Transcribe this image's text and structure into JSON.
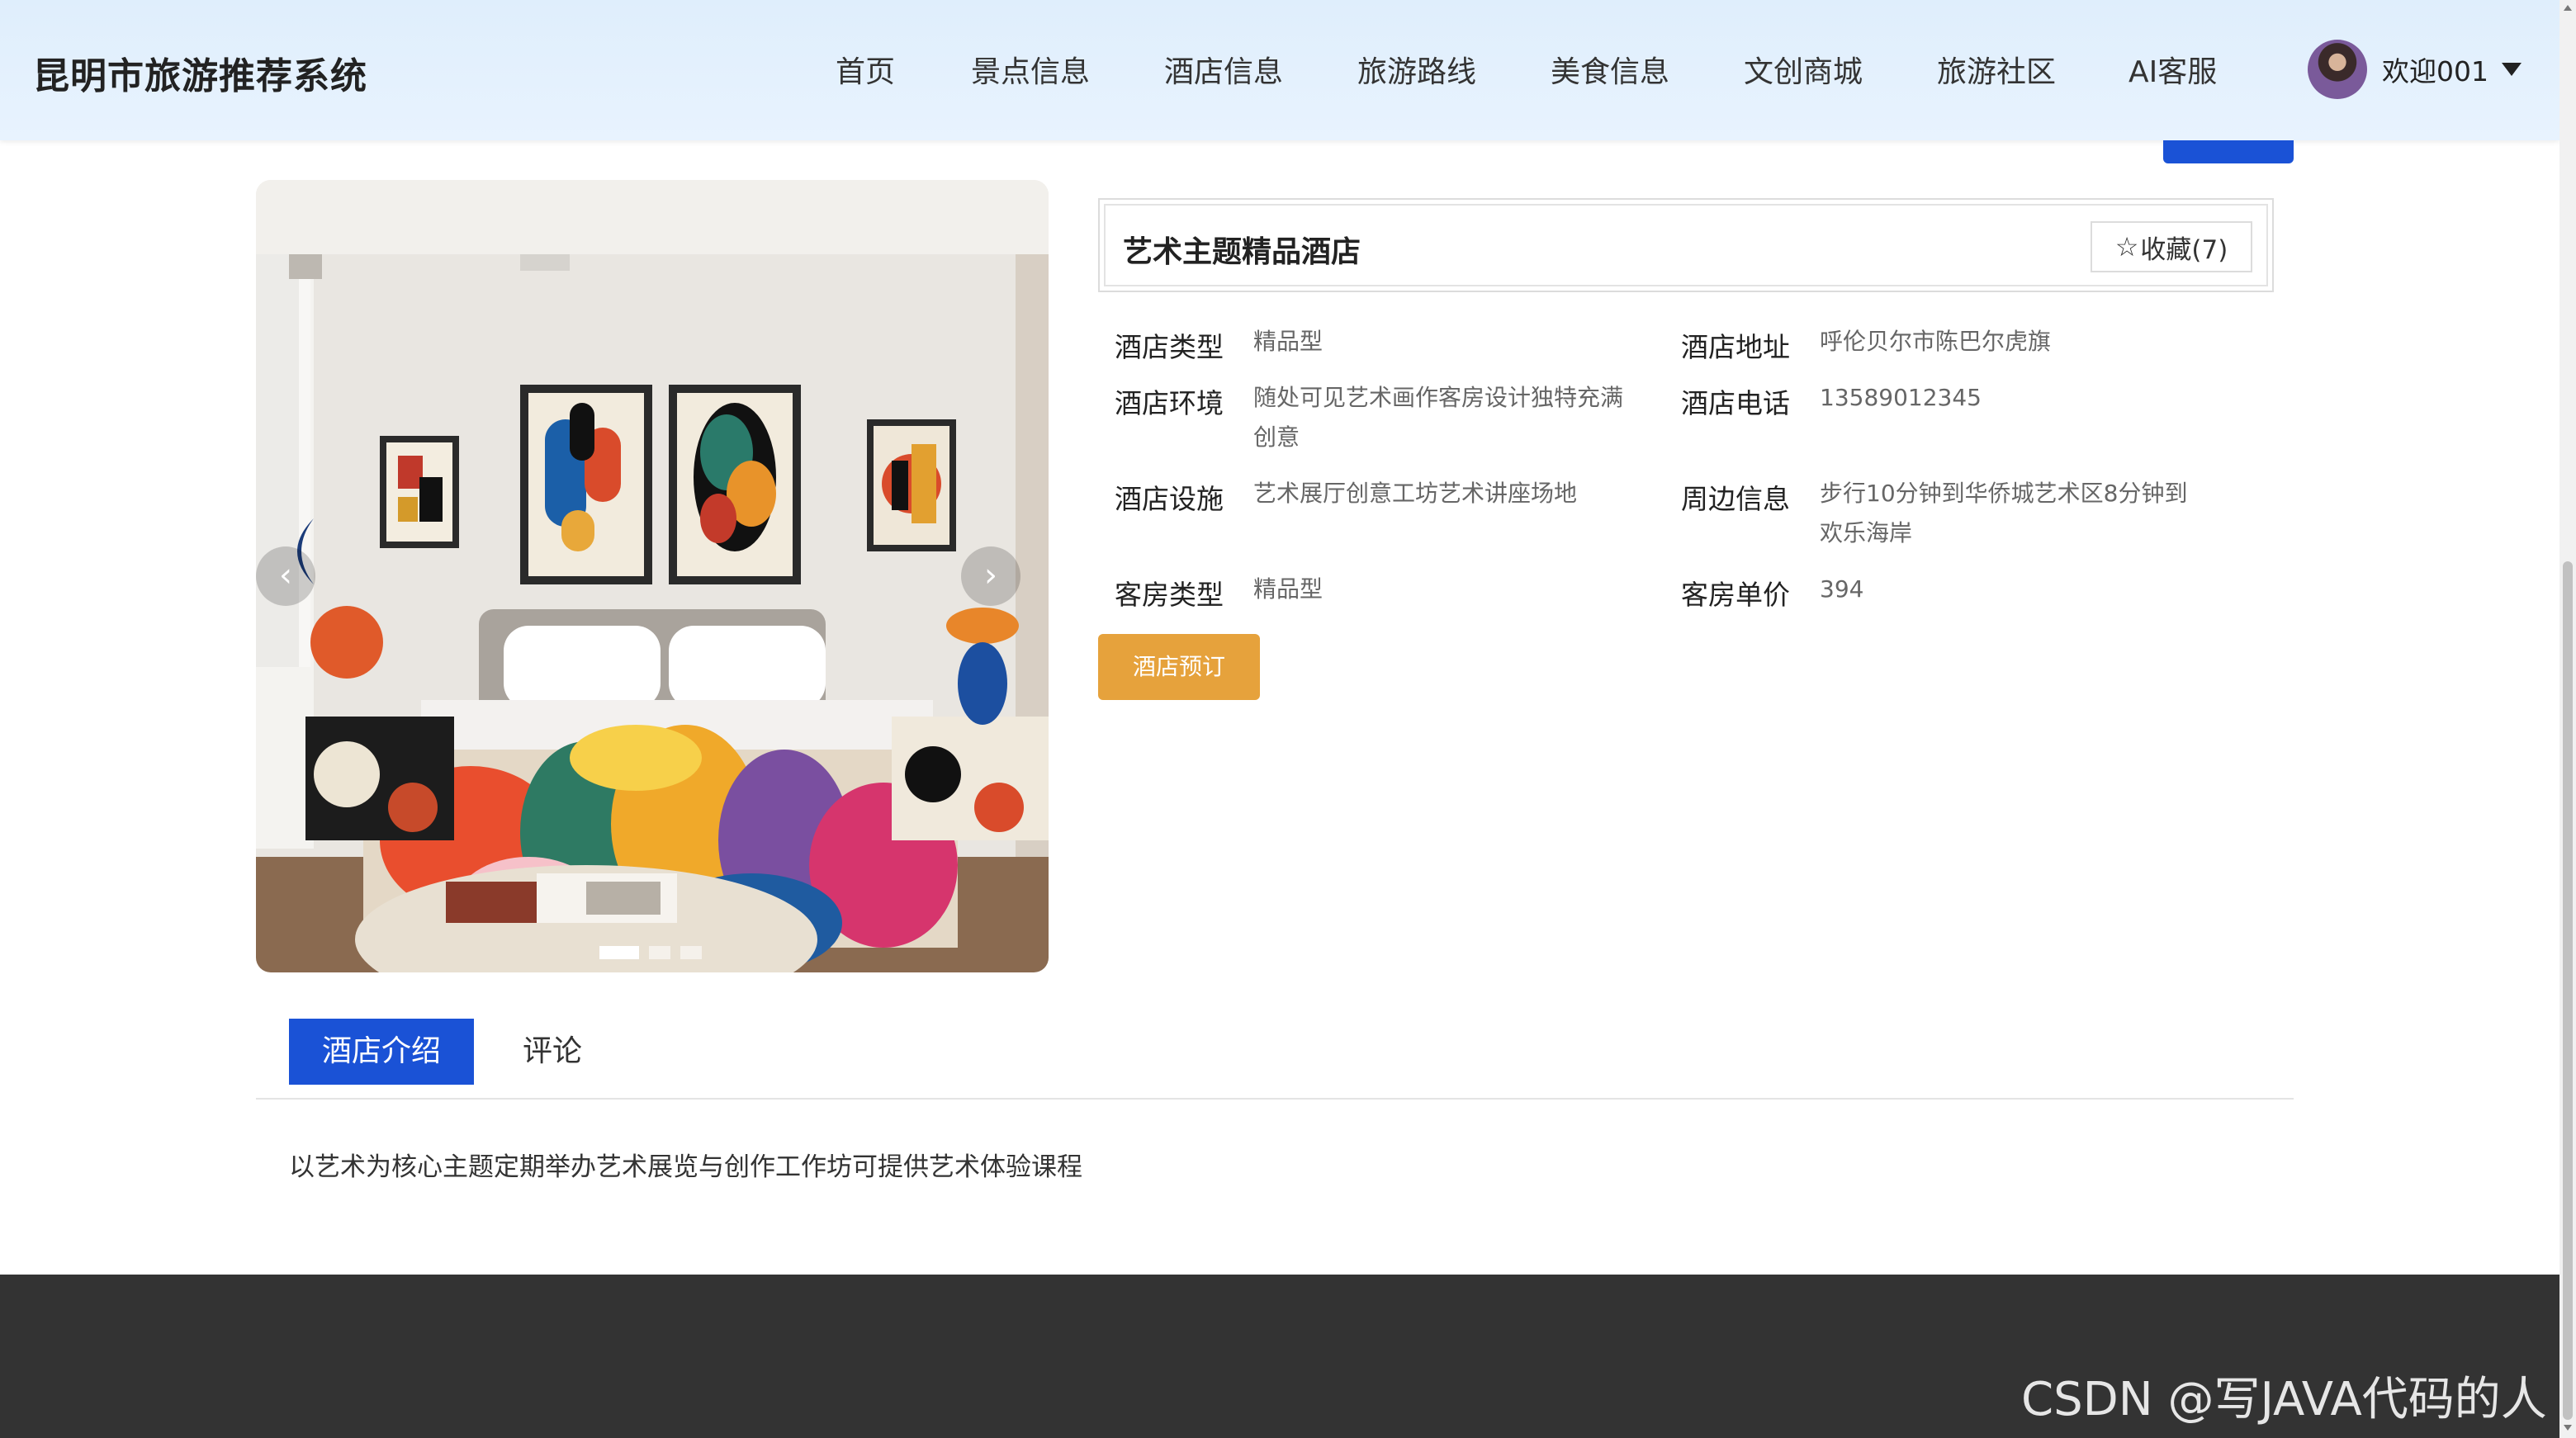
{
  "header": {
    "logo": "昆明市旅游推荐系统",
    "nav": [
      "首页",
      "景点信息",
      "酒店信息",
      "旅游路线",
      "美食信息",
      "文创商城",
      "旅游社区",
      "AI客服"
    ],
    "user": {
      "welcome": "欢迎001"
    }
  },
  "hotel": {
    "title": "艺术主题精品酒店",
    "favorite_label": "收藏(7)",
    "fields": {
      "type": {
        "label": "酒店类型",
        "value": "精品型"
      },
      "address": {
        "label": "酒店地址",
        "value": "呼伦贝尔市陈巴尔虎旗"
      },
      "environment": {
        "label": "酒店环境",
        "value": "随处可见艺术画作客房设计独特充满创意"
      },
      "phone": {
        "label": "酒店电话",
        "value": "13589012345"
      },
      "facilities": {
        "label": "酒店设施",
        "value": "艺术展厅创意工坊艺术讲座场地"
      },
      "nearby": {
        "label": "周边信息",
        "value": "步行10分钟到华侨城艺术区8分钟到欢乐海岸"
      },
      "room_type": {
        "label": "客房类型",
        "value": "精品型"
      },
      "room_price": {
        "label": "客房单价",
        "value": "394"
      }
    },
    "book_label": "酒店预订"
  },
  "carousel": {
    "prev": "‹",
    "next": "›",
    "slides": 3,
    "active_slide": 1
  },
  "tabs": [
    {
      "label": "酒店介绍",
      "active": true
    },
    {
      "label": "评论",
      "active": false
    }
  ],
  "intro_text": "以艺术为核心主题定期举办艺术展览与创作工作坊可提供艺术体验课程",
  "watermark": "CSDN @写JAVA代码的人",
  "colors": {
    "primary": "#1a52d6",
    "book": "#e6a23c",
    "footer": "#333333",
    "header": "#e2f0fd"
  }
}
